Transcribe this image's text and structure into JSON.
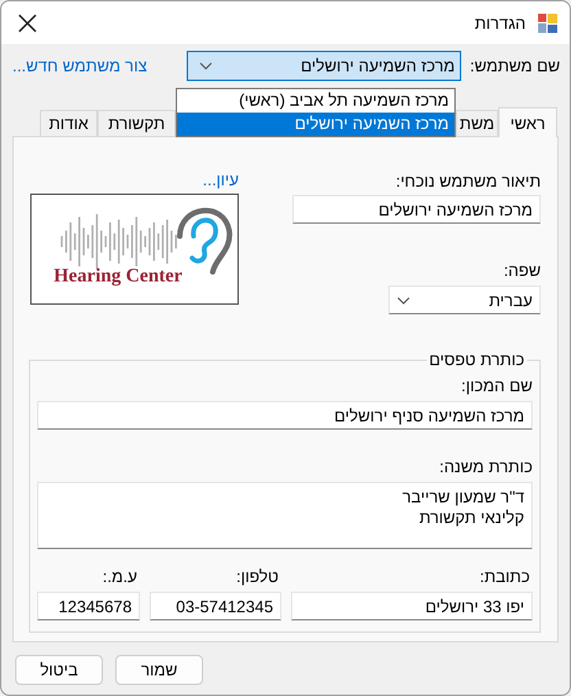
{
  "window": {
    "title": "הגדרות"
  },
  "user": {
    "label": "שם משתמש:",
    "value": "מרכז השמיעה ירושלים",
    "new_user_link": "צור משתמש חדש...",
    "options": [
      {
        "label": "מרכז השמיעה תל אביב (ראשי)",
        "selected": false
      },
      {
        "label": "מרכז השמיעה ירושלים",
        "selected": true
      }
    ]
  },
  "tabs": [
    {
      "label": "ראשי",
      "selected": true
    },
    {
      "label": "משת",
      "selected": false
    },
    {
      "label": "תקשורת",
      "selected": false
    },
    {
      "label": "אודות",
      "selected": false
    }
  ],
  "main": {
    "description_label": "תיאור משתמש נוכחי:",
    "description": "מרכז השמיעה ירושלים",
    "browse_link": "עיון...",
    "logo_text": "Hearing Center",
    "language_label": "שפה:",
    "language": "עברית"
  },
  "form_header": {
    "title": "כותרת טפסים",
    "institute_label": "שם המכון:",
    "institute": "מרכז השמיעה סניף ירושלים",
    "subtitle_label": "כותרת משנה:",
    "subtitle_lines": [
      "ד\"ר שמעון שרייבר",
      "קלינאי תקשורת"
    ],
    "address_label": "כתובת:",
    "address": "יפו 33 ירושלים",
    "phone_label": "טלפון:",
    "phone": "03-57412345",
    "id_label": "ע.מ.:",
    "id": "12345678"
  },
  "buttons": [
    {
      "label": "שמור"
    },
    {
      "label": "ביטול"
    }
  ]
}
